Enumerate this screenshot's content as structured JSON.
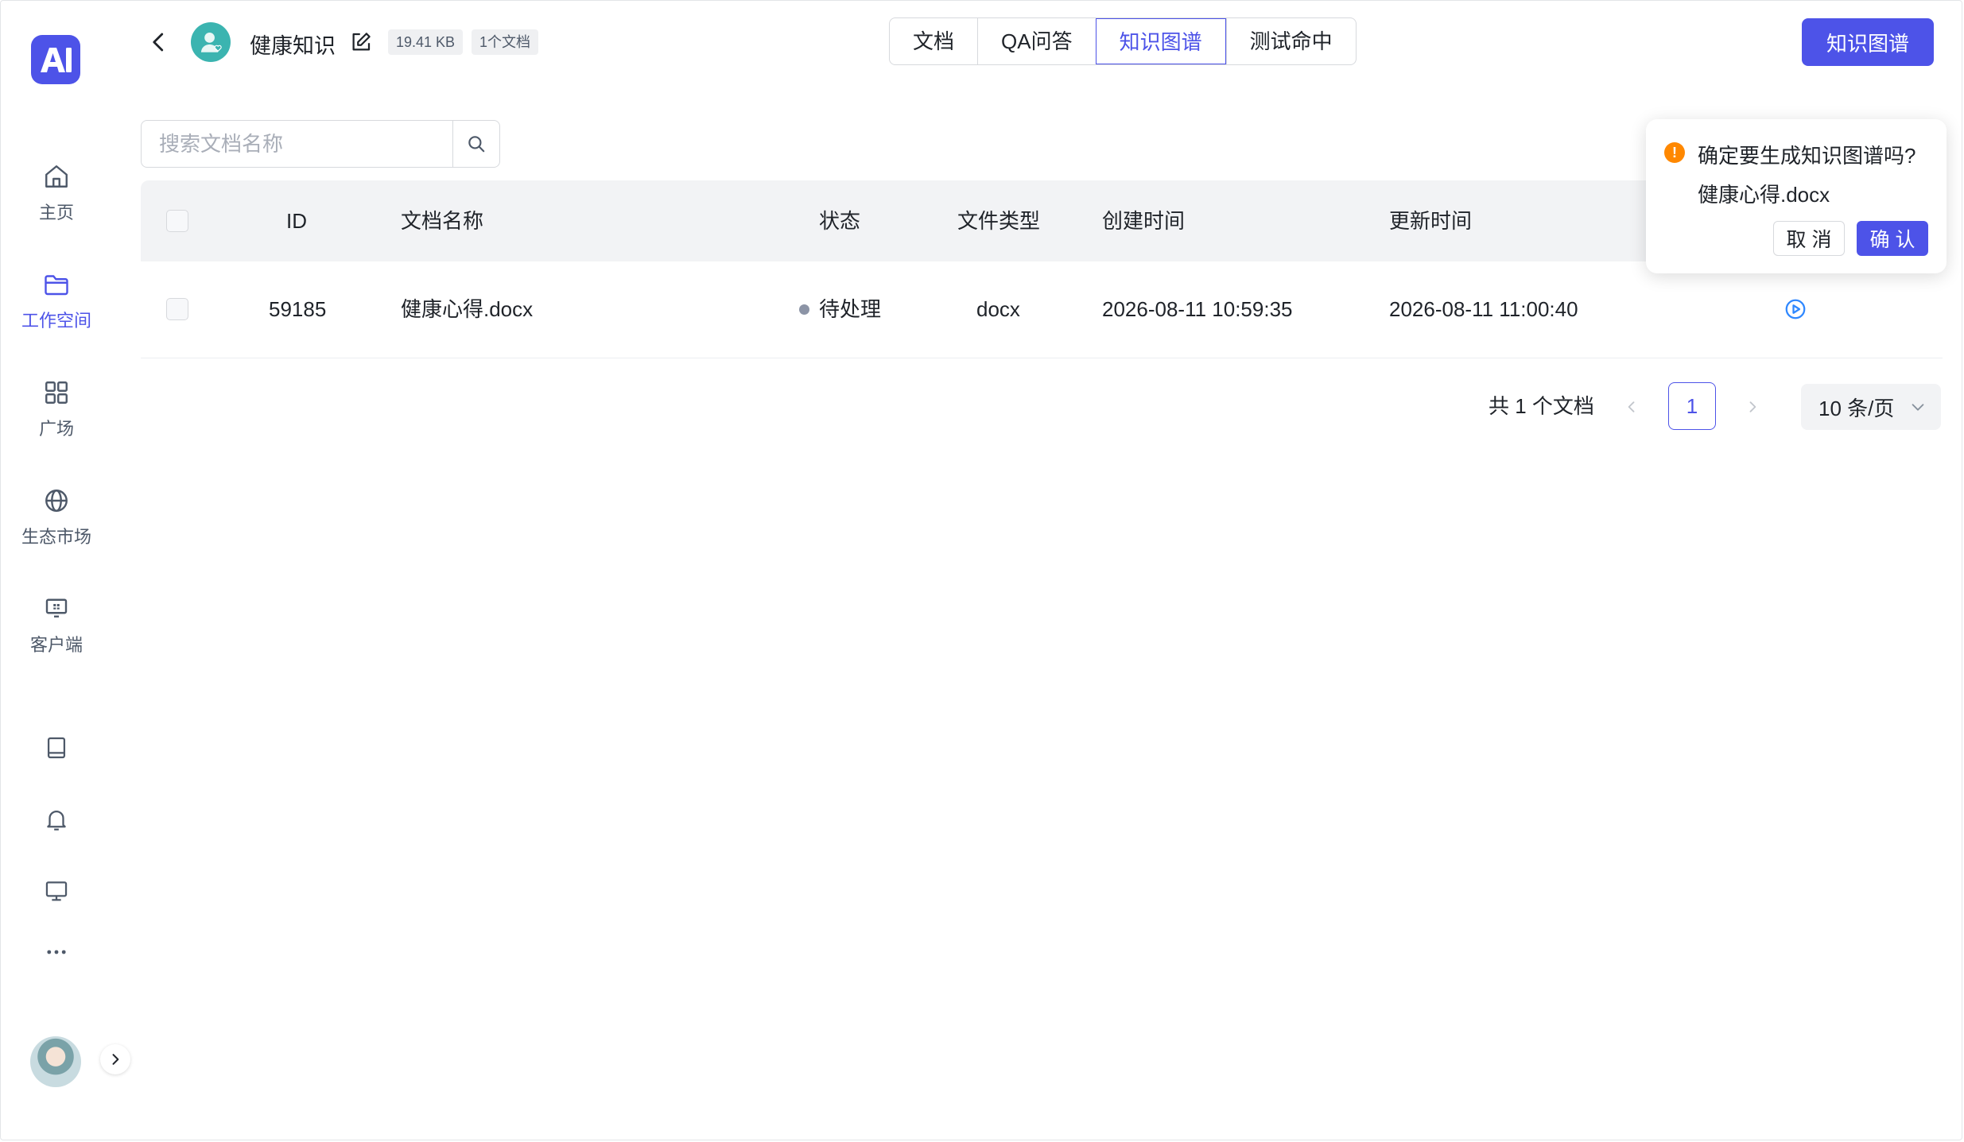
{
  "sidebar": {
    "items": [
      {
        "label": "主页",
        "icon": "home-icon"
      },
      {
        "label": "工作空间",
        "icon": "folder-icon",
        "active": true
      },
      {
        "label": "广场",
        "icon": "grid-icon"
      },
      {
        "label": "生态市场",
        "icon": "globe-icon"
      },
      {
        "label": "客户端",
        "icon": "client-icon"
      }
    ],
    "bottom_icons": [
      "book-icon",
      "bell-icon",
      "monitor-icon",
      "more-icon"
    ]
  },
  "header": {
    "title": "健康知识",
    "size_tag": "19.41 KB",
    "doc_count_tag": "1个文档",
    "tabs": [
      {
        "label": "文档"
      },
      {
        "label": "QA问答"
      },
      {
        "label": "知识图谱",
        "active": true
      },
      {
        "label": "测试命中"
      }
    ],
    "primary_button": "知识图谱"
  },
  "search": {
    "placeholder": "搜索文档名称",
    "value": ""
  },
  "table": {
    "columns": [
      "ID",
      "文档名称",
      "状态",
      "文件类型",
      "创建时间",
      "更新时间"
    ],
    "rows": [
      {
        "id": "59185",
        "name": "健康心得.docx",
        "status": "待处理",
        "file_type": "docx",
        "created": "2026-08-11 10:59:35",
        "updated": "2026-08-11 11:00:40"
      }
    ]
  },
  "pagination": {
    "total_text": "共 1 个文档",
    "current_page": "1",
    "page_size": "10 条/页"
  },
  "popconfirm": {
    "title": "确定要生成知识图谱吗?",
    "description": "健康心得.docx",
    "cancel": "取 消",
    "confirm": "确 认"
  },
  "colors": {
    "accent": "#4d53e8",
    "warning": "#ff8800",
    "status_pending": "#8c94a6",
    "action_icon": "#2f88ff"
  }
}
